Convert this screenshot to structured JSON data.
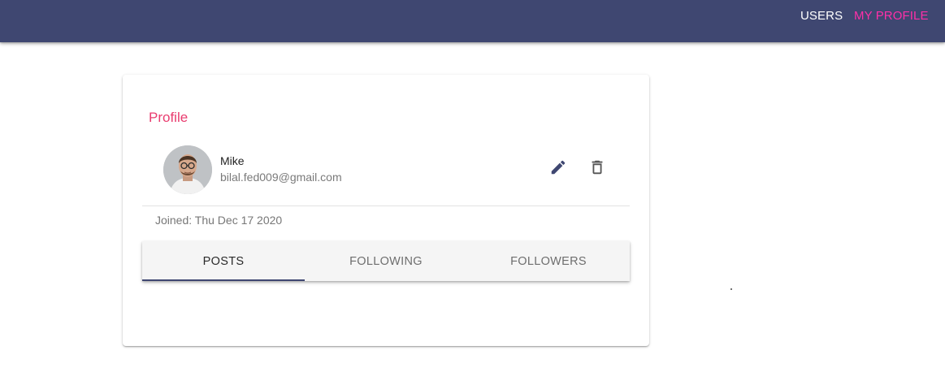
{
  "nav": {
    "users_label": "USERS",
    "my_profile_label": "MY PROFILE"
  },
  "profile": {
    "title": "Profile",
    "name": "Mike",
    "email": "bilal.fed009@gmail.com",
    "joined": "Joined: Thu Dec 17 2020"
  },
  "actions": {
    "edit_icon": "pencil-icon",
    "delete_icon": "trash-icon"
  },
  "tabs": [
    {
      "label": "POSTS",
      "active": true
    },
    {
      "label": "FOLLOWING",
      "active": false
    },
    {
      "label": "FOLLOWERS",
      "active": false
    }
  ],
  "colors": {
    "appbar": "#3f4771",
    "active_nav": "#ff2fa8",
    "title_accent": "#e93c6f",
    "tab_indicator": "#3f4771"
  }
}
